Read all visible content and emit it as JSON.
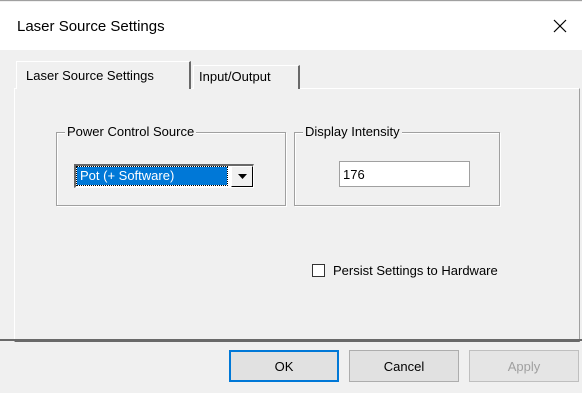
{
  "window": {
    "title": "Laser Source Settings"
  },
  "tabs": [
    {
      "label": "Laser Source Settings",
      "active": true
    },
    {
      "label": "Input/Output",
      "active": false
    }
  ],
  "power_control": {
    "group_label": "Power Control Source",
    "selected": "Pot (+ Software)"
  },
  "display_intensity": {
    "group_label": "Display Intensity",
    "value": "176"
  },
  "persist": {
    "label": "Persist Settings to Hardware",
    "checked": false
  },
  "buttons": {
    "ok": "OK",
    "cancel": "Cancel",
    "apply": "Apply"
  },
  "icons": {
    "close": "close-icon",
    "dropdown": "chevron-down-icon"
  }
}
